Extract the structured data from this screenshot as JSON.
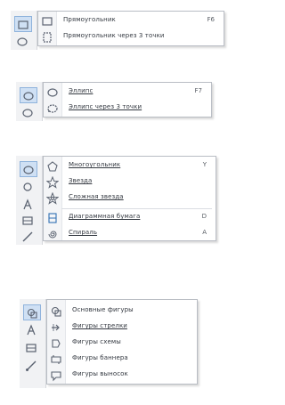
{
  "panel1": {
    "items": [
      {
        "label": "Прямоугольник",
        "shortcut": "F6",
        "icon": "rectangle-icon"
      },
      {
        "label": "Прямоугольник через 3 точки",
        "shortcut": "",
        "icon": "three-point-rectangle-icon"
      }
    ]
  },
  "panel2": {
    "items": [
      {
        "label": "Эллипс",
        "shortcut": "F7",
        "icon": "ellipse-icon"
      },
      {
        "label": "Эллипс через 3 точки",
        "shortcut": "",
        "icon": "three-point-ellipse-icon"
      }
    ]
  },
  "panel3": {
    "items": [
      {
        "label": "Многоугольник",
        "shortcut": "Y",
        "icon": "polygon-icon"
      },
      {
        "label": "Звезда",
        "shortcut": "",
        "icon": "star-icon"
      },
      {
        "label": "Сложная звезда",
        "shortcut": "",
        "icon": "complex-star-icon"
      },
      {
        "label": "Диаграммная бумага",
        "shortcut": "D",
        "icon": "graph-paper-icon"
      },
      {
        "label": "Спираль",
        "shortcut": "A",
        "icon": "spiral-icon"
      }
    ]
  },
  "panel4": {
    "items": [
      {
        "label": "Основные фигуры",
        "icon": "basic-shapes-icon"
      },
      {
        "label": "Фигуры стрелки",
        "icon": "arrow-shapes-icon"
      },
      {
        "label": "Фигуры схемы",
        "icon": "flowchart-shapes-icon"
      },
      {
        "label": "Фигуры баннера",
        "icon": "banner-shapes-icon"
      },
      {
        "label": "Фигуры выносок",
        "icon": "callout-shapes-icon"
      }
    ]
  },
  "colors": {
    "accent": "#2f6fb3",
    "active_bg": "#cfe0f4",
    "border": "#b9bdc4"
  }
}
